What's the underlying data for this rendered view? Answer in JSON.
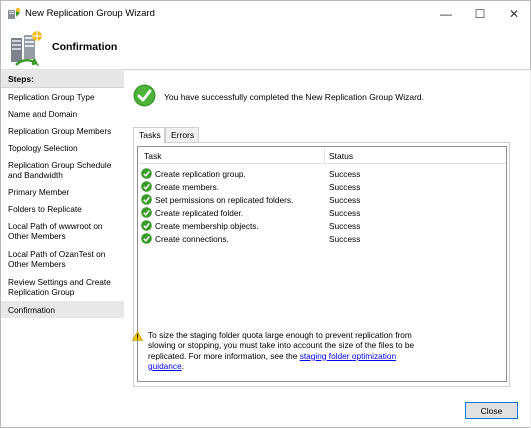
{
  "window": {
    "title": "New Replication Group Wizard",
    "controls": {
      "minimize": "—",
      "maximize": "☐",
      "close": "✕"
    }
  },
  "header": {
    "title": "Confirmation",
    "icon": "replication-group-icon"
  },
  "sidebar": {
    "heading": "Steps:",
    "items": [
      {
        "label": "Replication Group Type",
        "selected": false
      },
      {
        "label": "Name and Domain",
        "selected": false
      },
      {
        "label": "Replication Group Members",
        "selected": false
      },
      {
        "label": "Topology Selection",
        "selected": false
      },
      {
        "label": "Replication Group Schedule and Bandwidth",
        "selected": false
      },
      {
        "label": "Primary Member",
        "selected": false
      },
      {
        "label": "Folders to Replicate",
        "selected": false
      },
      {
        "label": "Local Path of wwwroot on Other Members",
        "selected": false
      },
      {
        "label": "Local Path of OzanTest on Other Members",
        "selected": false
      },
      {
        "label": "Review Settings and Create Replication Group",
        "selected": false
      },
      {
        "label": "Confirmation",
        "selected": true
      }
    ]
  },
  "main": {
    "success_message": "You have successfully completed the New Replication Group Wizard.",
    "tabs": [
      {
        "label": "Tasks",
        "active": true
      },
      {
        "label": "Errors",
        "active": false
      }
    ],
    "table": {
      "columns": [
        "Task",
        "Status"
      ],
      "rows": [
        {
          "task": "Create replication group.",
          "status": "Success"
        },
        {
          "task": "Create members.",
          "status": "Success"
        },
        {
          "task": "Set permissions on replicated folders.",
          "status": "Success"
        },
        {
          "task": "Create replicated folder.",
          "status": "Success"
        },
        {
          "task": "Create membership objects.",
          "status": "Success"
        },
        {
          "task": "Create connections.",
          "status": "Success"
        }
      ]
    },
    "warning": {
      "text": "To size the staging folder quota large enough to prevent replication from slowing or stopping, you must take into account the size of the files to be replicated. For more information, see the ",
      "link": "staging folder optimization guidance",
      "suffix": "."
    },
    "close_label": "Close"
  },
  "colors": {
    "success_green": "#3a9b2a",
    "link_blue": "#0000ee",
    "button_border": "#0078d7",
    "warning_yellow": "#f5c400"
  }
}
